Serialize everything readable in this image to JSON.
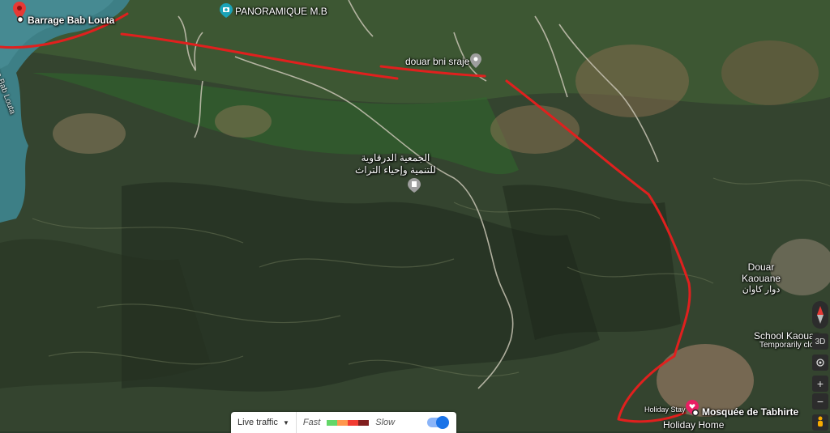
{
  "map": {
    "places": {
      "barrage": "Barrage Bab Louta",
      "water_label": "Barrage Bab Louta",
      "panoramique": "PANORAMIQUE M.B",
      "douar_bni": "douar bni sraje",
      "association_line1": "الجمعية الدرقاوية",
      "association_line2": "للتنمية وإحياء التراث",
      "douar_kaouane_line1": "Douar",
      "douar_kaouane_line2": "Kaouane",
      "douar_kaouane_arabic": "دوار كاوان",
      "school": "School Kaouan",
      "school_status": "Temporarily close",
      "holiday_stay": "Holiday Stay",
      "holiday_home": "Holiday Home",
      "mosque": "Mosquée de Tabhirte"
    },
    "controls": {
      "view_3d": "3D"
    },
    "colors": {
      "route": "#e0201e",
      "pin_red": "#e53935",
      "pin_teal": "#1aa3b8",
      "pin_gray": "#9e9e9e"
    }
  },
  "traffic": {
    "selector_label": "Live traffic",
    "fast_label": "Fast",
    "slow_label": "Slow",
    "colors": [
      "#63d668",
      "#ff974d",
      "#f23c32",
      "#811f1f"
    ],
    "toggle_on": true
  }
}
